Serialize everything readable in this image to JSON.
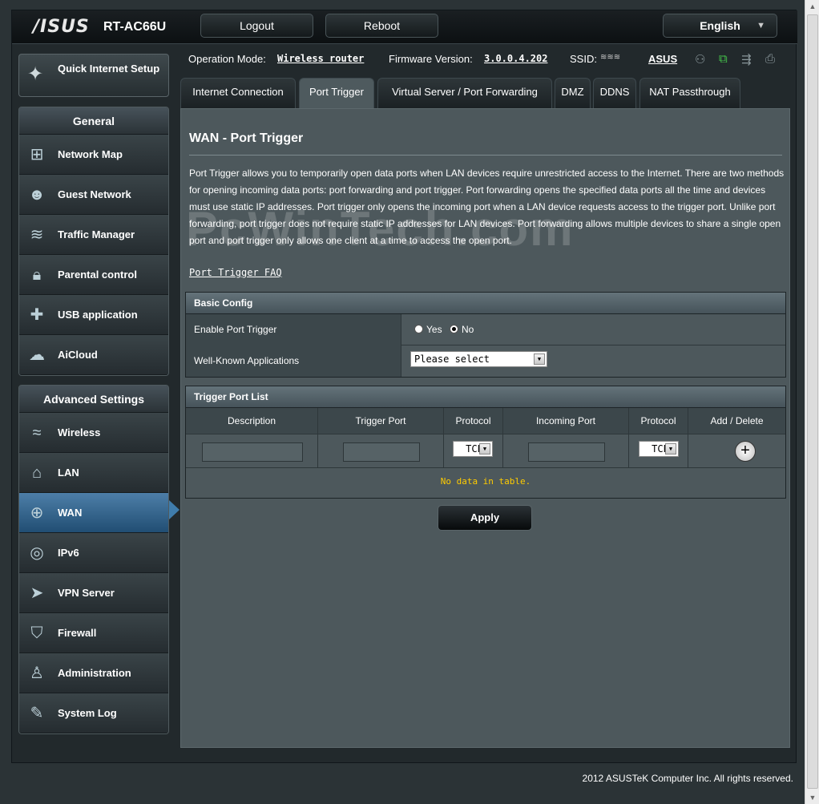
{
  "header": {
    "logo": "/ISUS",
    "model": "RT-AC66U",
    "logout_label": "Logout",
    "reboot_label": "Reboot",
    "language": "English"
  },
  "status": {
    "op_mode_label": "Operation Mode:",
    "op_mode_value": "Wireless router",
    "firmware_label": "Firmware Version:",
    "firmware_value": "3.0.0.4.202",
    "ssid_label": "SSID:",
    "ssid_value": "ASUS"
  },
  "sidebar": {
    "quick_setup_label": "Quick Internet Setup",
    "general_title": "General",
    "general_items": [
      {
        "label": "Network Map",
        "icon": "network-map-icon"
      },
      {
        "label": "Guest Network",
        "icon": "guest-network-icon"
      },
      {
        "label": "Traffic Manager",
        "icon": "traffic-manager-icon"
      },
      {
        "label": "Parental control",
        "icon": "lock-icon"
      },
      {
        "label": "USB application",
        "icon": "puzzle-icon"
      },
      {
        "label": "AiCloud",
        "icon": "cloud-icon"
      }
    ],
    "advanced_title": "Advanced Settings",
    "advanced_items": [
      {
        "label": "Wireless",
        "icon": "wifi-icon"
      },
      {
        "label": "LAN",
        "icon": "home-icon"
      },
      {
        "label": "WAN",
        "icon": "globe-icon"
      },
      {
        "label": "IPv6",
        "icon": "ipv6-icon"
      },
      {
        "label": "VPN Server",
        "icon": "vpn-icon"
      },
      {
        "label": "Firewall",
        "icon": "shield-icon"
      },
      {
        "label": "Administration",
        "icon": "user-icon"
      },
      {
        "label": "System Log",
        "icon": "log-icon"
      }
    ]
  },
  "tabs": [
    "Internet Connection",
    "Port Trigger",
    "Virtual Server / Port Forwarding",
    "DMZ",
    "DDNS",
    "NAT Passthrough"
  ],
  "page": {
    "title": "WAN - Port Trigger",
    "description": "Port Trigger allows you to temporarily open data ports when LAN devices require unrestricted access to the Internet. There are two methods for opening incoming data ports: port forwarding and port trigger. Port forwarding opens the specified data ports all the time and devices must use static IP addresses. Port trigger only opens the incoming port when a LAN device requests access to the trigger port. Unlike port forwarding, port trigger does not require static IP addresses for LAN devices. Port forwarding allows multiple devices to share a single open port and port trigger only allows one client at a time to access the open port.",
    "faq_link": "Port Trigger FAQ",
    "watermark": "PcWinTech.com"
  },
  "basic_config": {
    "title": "Basic Config",
    "enable_label": "Enable Port Trigger",
    "yes_label": "Yes",
    "no_label": "No",
    "selected": "No",
    "apps_label": "Well-Known Applications",
    "apps_value": "Please select"
  },
  "trigger_list": {
    "title": "Trigger Port List",
    "columns": [
      "Description",
      "Trigger Port",
      "Protocol",
      "Incoming Port",
      "Protocol",
      "Add / Delete"
    ],
    "trigger_protocol": "TCP",
    "incoming_protocol": "TCP",
    "empty_message": "No data in table."
  },
  "apply_label": "Apply",
  "footer": "2012 ASUSTeK Computer Inc. All rights reserved.",
  "colors": {
    "active_nav": "#3f7cab",
    "panel": "#4d585c",
    "empty_text": "#ffcc00"
  }
}
